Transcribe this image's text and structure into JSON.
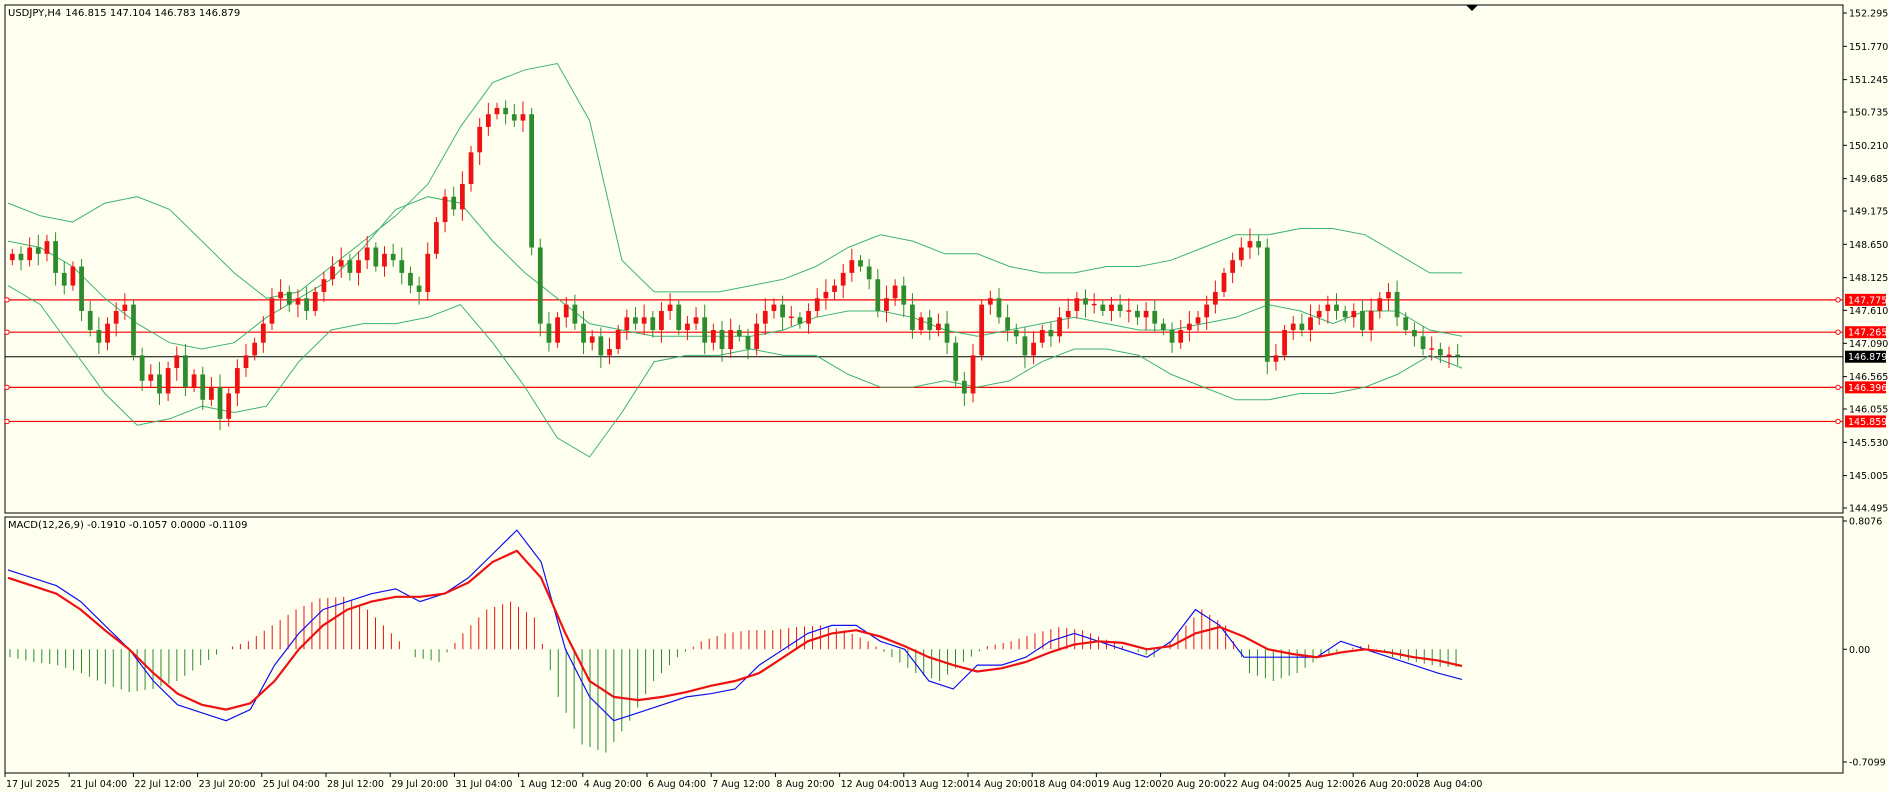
{
  "header": {
    "symbol": "USDJPY,H4",
    "ohlc": "146.815 147.104 146.783 146.879"
  },
  "macd_header": "MACD(12,26,9) -0.1910 -0.1057 0.0000 -0.1109",
  "colors": {
    "background": "#fffff0",
    "bull": "#ee1111",
    "bear": "#2e8b2e",
    "bollinger": "#3cb371",
    "level_line": "#ff0000",
    "current_line": "#000000",
    "macd_line": "#1010ee",
    "signal_line": "#ee1111"
  },
  "chart_data": [
    {
      "type": "candlestick",
      "title": "USDJPY,H4",
      "ylim": [
        144.495,
        152.295
      ],
      "y_ticks": [
        "152.295",
        "151.770",
        "151.245",
        "150.735",
        "150.210",
        "149.685",
        "149.175",
        "148.650",
        "148.125",
        "147.610",
        "147.090",
        "146.565",
        "146.055",
        "145.530",
        "145.005",
        "144.495"
      ],
      "x_ticks": [
        "17 Jul 2025",
        "21 Jul 04:00",
        "22 Jul 12:00",
        "23 Jul 20:00",
        "25 Jul 04:00",
        "28 Jul 12:00",
        "29 Jul 20:00",
        "31 Jul 04:00",
        "1 Aug 12:00",
        "4 Aug 20:00",
        "6 Aug 04:00",
        "7 Aug 12:00",
        "8 Aug 20:00",
        "12 Aug 04:00",
        "13 Aug 12:00",
        "14 Aug 20:00",
        "18 Aug 04:00",
        "19 Aug 12:00",
        "20 Aug 20:00",
        "22 Aug 04:00",
        "25 Aug 12:00",
        "26 Aug 20:00",
        "28 Aug 04:00"
      ],
      "close_path": [
        148.5,
        148.4,
        148.6,
        148.5,
        148.7,
        148.2,
        148.0,
        148.3,
        147.6,
        147.3,
        147.1,
        147.4,
        147.6,
        147.7,
        146.9,
        146.5,
        146.6,
        146.3,
        146.7,
        146.9,
        146.4,
        146.6,
        146.2,
        146.4,
        145.9,
        146.3,
        146.7,
        146.9,
        147.1,
        147.4,
        147.8,
        147.9,
        147.7,
        147.8,
        147.6,
        147.9,
        148.1,
        148.3,
        148.4,
        148.2,
        148.4,
        148.6,
        148.3,
        148.5,
        148.4,
        148.2,
        148.0,
        147.9,
        148.5,
        149.0,
        149.4,
        149.2,
        149.6,
        150.1,
        150.5,
        150.7,
        150.8,
        150.7,
        150.6,
        150.7,
        148.6,
        147.4,
        147.1,
        147.5,
        147.7,
        147.4,
        147.1,
        147.2,
        146.9,
        147.0,
        147.3,
        147.5,
        147.4,
        147.5,
        147.3,
        147.6,
        147.7,
        147.3,
        147.4,
        147.5,
        147.1,
        147.3,
        147.0,
        147.3,
        147.2,
        147.0,
        147.4,
        147.6,
        147.7,
        147.5,
        147.5,
        147.4,
        147.6,
        147.8,
        147.9,
        148.0,
        148.2,
        148.4,
        148.3,
        148.1,
        147.6,
        147.8,
        148.0,
        147.7,
        147.3,
        147.5,
        147.3,
        147.4,
        147.1,
        146.5,
        146.3,
        146.9,
        147.7,
        147.8,
        147.5,
        147.3,
        147.2,
        146.9,
        147.1,
        147.3,
        147.2,
        147.5,
        147.6,
        147.8,
        147.7,
        147.7,
        147.6,
        147.7,
        147.6,
        147.6,
        147.5,
        147.6,
        147.4,
        147.3,
        147.1,
        147.3,
        147.4,
        147.5,
        147.7,
        147.9,
        148.2,
        148.4,
        148.6,
        148.7,
        148.6,
        146.8,
        146.9,
        147.3,
        147.4,
        147.3,
        147.5,
        147.6,
        147.7,
        147.6,
        147.5,
        147.6,
        147.3,
        147.6,
        147.8,
        147.9,
        147.5,
        147.3,
        147.2,
        147.0,
        147.0,
        146.9,
        146.9,
        146.88
      ],
      "bollinger": {
        "upper": [
          149.3,
          149.1,
          149.0,
          149.3,
          149.4,
          149.2,
          148.7,
          148.2,
          147.8,
          147.9,
          148.3,
          148.7,
          149.1,
          149.6,
          150.5,
          151.2,
          151.4,
          151.5,
          150.6,
          148.4,
          147.9,
          147.9,
          147.9,
          148.0,
          148.1,
          148.3,
          148.6,
          148.8,
          148.7,
          148.5,
          148.5,
          148.3,
          148.2,
          148.2,
          148.3,
          148.3,
          148.4,
          148.6,
          148.8,
          148.8,
          148.9,
          148.9,
          148.8,
          148.5,
          148.2,
          148.2
        ],
        "middle": [
          148.7,
          148.6,
          148.3,
          147.8,
          147.4,
          147.1,
          147.0,
          147.1,
          147.5,
          147.8,
          148.1,
          148.6,
          149.2,
          149.4,
          149.3,
          148.7,
          148.2,
          147.8,
          147.4,
          147.3,
          147.2,
          147.2,
          147.2,
          147.2,
          147.3,
          147.5,
          147.6,
          147.6,
          147.5,
          147.3,
          147.2,
          147.3,
          147.4,
          147.5,
          147.4,
          147.3,
          147.3,
          147.4,
          147.5,
          147.7,
          147.6,
          147.4,
          147.6,
          147.6,
          147.3,
          147.2
        ],
        "lower": [
          148.0,
          147.7,
          147.0,
          146.3,
          145.8,
          145.9,
          146.1,
          146.0,
          146.1,
          146.8,
          147.3,
          147.4,
          147.4,
          147.5,
          147.7,
          147.1,
          146.4,
          145.6,
          145.3,
          146.0,
          146.8,
          146.9,
          146.9,
          147.0,
          146.9,
          146.9,
          146.6,
          146.4,
          146.4,
          146.5,
          146.4,
          146.5,
          146.8,
          147.0,
          147.0,
          146.9,
          146.6,
          146.4,
          146.2,
          146.2,
          146.3,
          146.3,
          146.4,
          146.6,
          146.9,
          146.7
        ]
      },
      "levels": [
        {
          "label": "147.775",
          "value": 147.775
        },
        {
          "label": "147.265",
          "value": 147.265
        },
        {
          "label": "146.396",
          "value": 146.396
        },
        {
          "label": "145.859",
          "value": 145.859
        }
      ],
      "current_price": {
        "label": "146.879",
        "value": 146.879
      }
    },
    {
      "type": "macd",
      "title": "MACD(12,26,9) -0.1910 -0.1057 0.0000 -0.1109",
      "ylim": [
        -0.7099,
        0.8076
      ],
      "y_ticks": [
        "0.8076",
        "0.00",
        "-0.7099"
      ],
      "macd": [
        0.5,
        0.45,
        0.4,
        0.3,
        0.15,
        0.0,
        -0.2,
        -0.35,
        -0.4,
        -0.45,
        -0.38,
        -0.1,
        0.1,
        0.25,
        0.3,
        0.35,
        0.38,
        0.3,
        0.35,
        0.45,
        0.6,
        0.75,
        0.55,
        0.0,
        -0.3,
        -0.45,
        -0.4,
        -0.35,
        -0.3,
        -0.28,
        -0.25,
        -0.1,
        0.0,
        0.1,
        0.15,
        0.15,
        0.05,
        0.0,
        -0.2,
        -0.25,
        -0.1,
        -0.1,
        -0.05,
        0.05,
        0.1,
        0.05,
        0.0,
        -0.05,
        0.05,
        0.25,
        0.15,
        -0.05,
        -0.05,
        -0.05,
        -0.05,
        0.05,
        0.0,
        -0.05,
        -0.1,
        -0.15,
        -0.19
      ],
      "signal": [
        0.45,
        0.4,
        0.35,
        0.25,
        0.12,
        0.0,
        -0.15,
        -0.28,
        -0.35,
        -0.38,
        -0.34,
        -0.2,
        0.0,
        0.15,
        0.25,
        0.3,
        0.33,
        0.33,
        0.35,
        0.42,
        0.55,
        0.62,
        0.45,
        0.1,
        -0.2,
        -0.3,
        -0.32,
        -0.3,
        -0.27,
        -0.23,
        -0.2,
        -0.15,
        -0.05,
        0.05,
        0.1,
        0.12,
        0.08,
        0.02,
        -0.05,
        -0.1,
        -0.14,
        -0.12,
        -0.08,
        -0.02,
        0.03,
        0.05,
        0.04,
        0.0,
        0.02,
        0.1,
        0.14,
        0.08,
        0.0,
        -0.03,
        -0.05,
        -0.02,
        0.0,
        -0.02,
        -0.05,
        -0.07,
        -0.1057
      ],
      "histogram": [
        -0.05,
        -0.08,
        -0.1,
        -0.15,
        -0.22,
        -0.27,
        -0.25,
        -0.2,
        -0.1,
        0.0,
        0.05,
        0.15,
        0.25,
        0.32,
        0.33,
        0.25,
        0.1,
        -0.05,
        -0.08,
        0.1,
        0.25,
        0.3,
        0.2,
        -0.3,
        -0.6,
        -0.65,
        -0.45,
        -0.2,
        -0.05,
        0.05,
        0.1,
        0.12,
        0.12,
        0.14,
        0.15,
        0.12,
        0.05,
        -0.05,
        -0.15,
        -0.2,
        -0.08,
        0.02,
        0.05,
        0.1,
        0.14,
        0.12,
        0.06,
        0.0,
        -0.05,
        0.1,
        0.25,
        0.15,
        -0.15,
        -0.2,
        -0.15,
        -0.05,
        0.0,
        0.03,
        -0.05,
        -0.08,
        -0.1109
      ]
    }
  ]
}
